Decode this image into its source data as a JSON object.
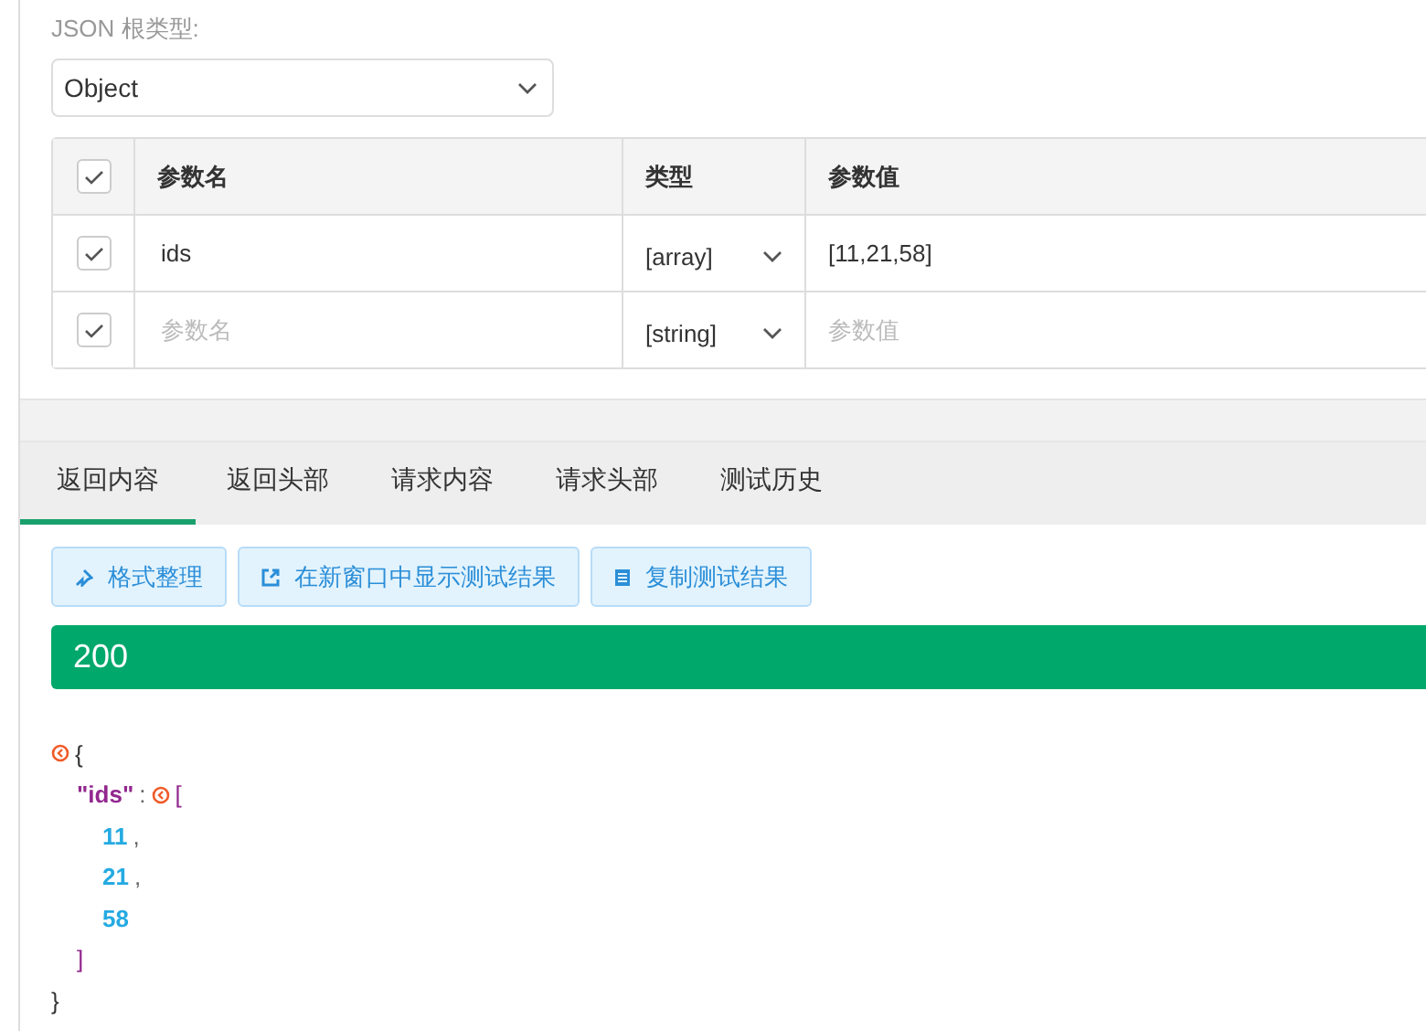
{
  "root_type": {
    "label": "JSON 根类型:",
    "value": "Object"
  },
  "params_table": {
    "all_checked": true,
    "columns": [
      "参数名",
      "类型",
      "参数值"
    ],
    "rows": [
      {
        "checked": true,
        "name": "ids",
        "type": "[array]",
        "value": "[11,21,58]"
      },
      {
        "checked": true,
        "name": "",
        "name_placeholder": "参数名",
        "type": "[string]",
        "value": "",
        "value_placeholder": "参数值"
      }
    ]
  },
  "tabs": [
    {
      "label": "返回内容",
      "selected": true
    },
    {
      "label": "返回头部",
      "selected": false
    },
    {
      "label": "请求内容",
      "selected": false
    },
    {
      "label": "请求头部",
      "selected": false
    },
    {
      "label": "测试历史",
      "selected": false
    }
  ],
  "actions": [
    {
      "kind": "format",
      "label": "格式整理"
    },
    {
      "kind": "open",
      "label": "在新窗口中显示测试结果"
    },
    {
      "kind": "copy",
      "label": "复制测试结果"
    }
  ],
  "status_code": "200",
  "response": {
    "open": "{",
    "close": "}",
    "collapsible": true,
    "children": [
      {
        "key": "\"ids\"",
        "separator": ":",
        "open": "[",
        "close": "]",
        "collapsible": true,
        "children": [
          {
            "value": "11",
            "comma": ","
          },
          {
            "value": "21",
            "comma": ","
          },
          {
            "value": "58"
          }
        ]
      }
    ]
  }
}
